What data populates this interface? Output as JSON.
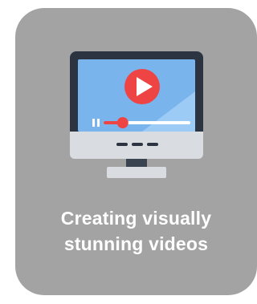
{
  "card": {
    "caption_line1": "Creating visually",
    "caption_line2": "stunning videos",
    "background_color": "#a3a3a3"
  },
  "illustration": {
    "icon": "monitor-video-player-icon",
    "play_button_color": "#ef4444",
    "screen_color": "#8ec5f5",
    "playback_progress": 0.22
  }
}
